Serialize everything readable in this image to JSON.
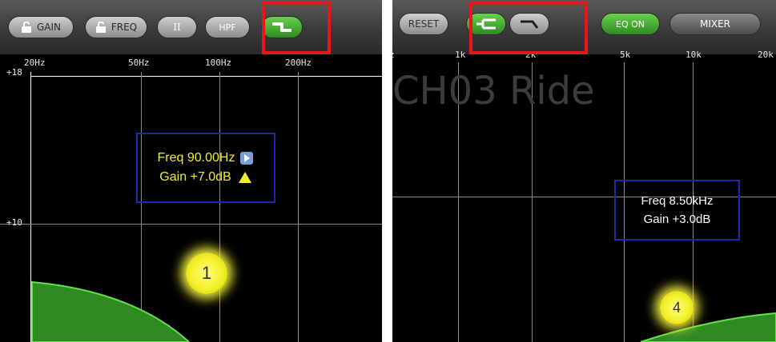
{
  "left": {
    "toolbar": {
      "gain_label": "GAIN",
      "freq_label": "FREQ",
      "q_label": "II",
      "hpf_label": "HPF"
    },
    "hz_ticks": [
      "20Hz",
      "50Hz",
      "100Hz",
      "200Hz"
    ],
    "db_labels": [
      "+18",
      "+10"
    ],
    "info": {
      "freq_text": "Freq  90.00Hz",
      "gain_text": "Gain +7.0dB",
      "text_color": "#f2ee2a"
    },
    "band_number": "1"
  },
  "right": {
    "toolbar": {
      "reset_label": "RESET",
      "eq_on_label": "EQ ON",
      "mixer_label": "MIXER"
    },
    "hz_ticks": [
      "1k",
      "2k",
      "5k",
      "10k",
      "20k"
    ],
    "channel_name": "CH03 Ride",
    "info": {
      "freq_text": "Freq  8.50kHz",
      "gain_text": "Gain +3.0dB",
      "text_color": "#ffffff"
    },
    "band_number": "4"
  },
  "colors": {
    "curve_fill": "#2f8a22",
    "curve_edge": "#66e04a",
    "highlight": "#e8161a",
    "info_border": "#1c2aa8",
    "band_glow": "#f4f23c"
  },
  "icons": [
    "lock-icon",
    "shelf-filter-icon",
    "peaking-filter-icon",
    "high-cut-filter-icon",
    "play-arrow-icon",
    "warning-triangle-icon"
  ]
}
